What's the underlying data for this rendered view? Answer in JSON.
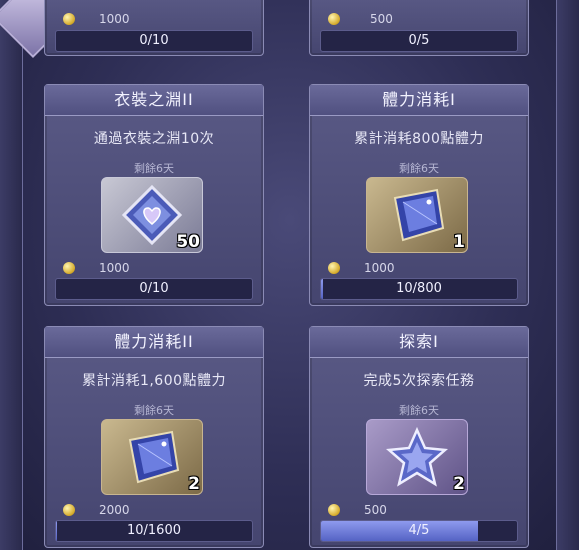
{
  "cards": [
    {
      "title": "",
      "reward": "1000",
      "progress_text": "0/10",
      "progress": 0
    },
    {
      "title": "",
      "reward": "500",
      "progress_text": "0/5",
      "progress": 0
    },
    {
      "title": "衣裝之淵II",
      "description": "通過衣裝之淵10次",
      "remaining": "剩餘6天",
      "item_icon": "heart-crystal-icon",
      "item_qty": "50",
      "reward": "1000",
      "progress_text": "0/10",
      "progress": 0
    },
    {
      "title": "體力消耗I",
      "description": "累計消耗800點體力",
      "remaining": "剩餘6天",
      "item_icon": "blue-crystal-icon",
      "item_qty": "1",
      "reward": "1000",
      "progress_text": "10/800",
      "progress": 0.0125
    },
    {
      "title": "體力消耗II",
      "description": "累計消耗1,600點體力",
      "remaining": "剩餘6天",
      "item_icon": "blue-crystal-icon",
      "item_qty": "2",
      "reward": "2000",
      "progress_text": "10/1600",
      "progress": 0.00625
    },
    {
      "title": "探索I",
      "description": "完成5次探索任務",
      "remaining": "剩餘6天",
      "item_icon": "star-emblem-icon",
      "item_qty": "2",
      "reward": "500",
      "progress_text": "4/5",
      "progress": 0.8
    }
  ],
  "colors": {
    "progress_fill": "#6f7be0",
    "panel": "#4d4d7a",
    "coin": "#d4a928"
  }
}
